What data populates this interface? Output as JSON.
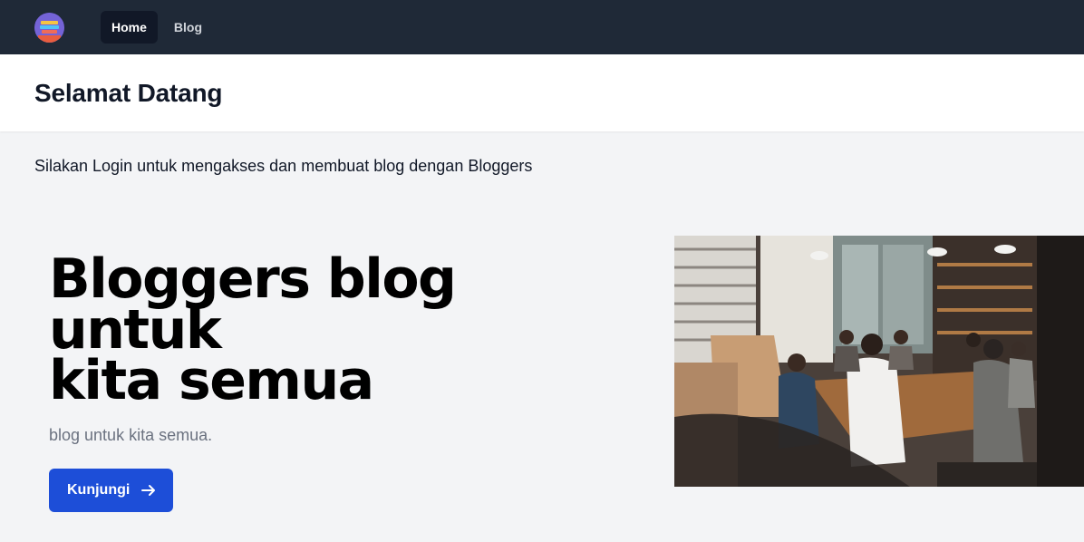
{
  "nav": {
    "logo_icon": "bloggers-logo-icon",
    "links": [
      {
        "label": "Home",
        "active": true
      },
      {
        "label": "Blog",
        "active": false
      }
    ]
  },
  "header": {
    "title": "Selamat Datang"
  },
  "intro": {
    "text": "Silakan Login untuk mengakses dan membuat blog dengan Bloggers"
  },
  "hero": {
    "title_line1": "Bloggers blog untuk",
    "title_line2": "kita semua",
    "subtitle": "blog untuk kita semua.",
    "cta_label": "Kunjungi",
    "cta_icon": "arrow-right-icon",
    "image_icon": "team-meeting-photo"
  },
  "colors": {
    "nav_bg": "#1f2937",
    "accent": "#1d4ed8",
    "page_bg": "#f3f4f6"
  }
}
